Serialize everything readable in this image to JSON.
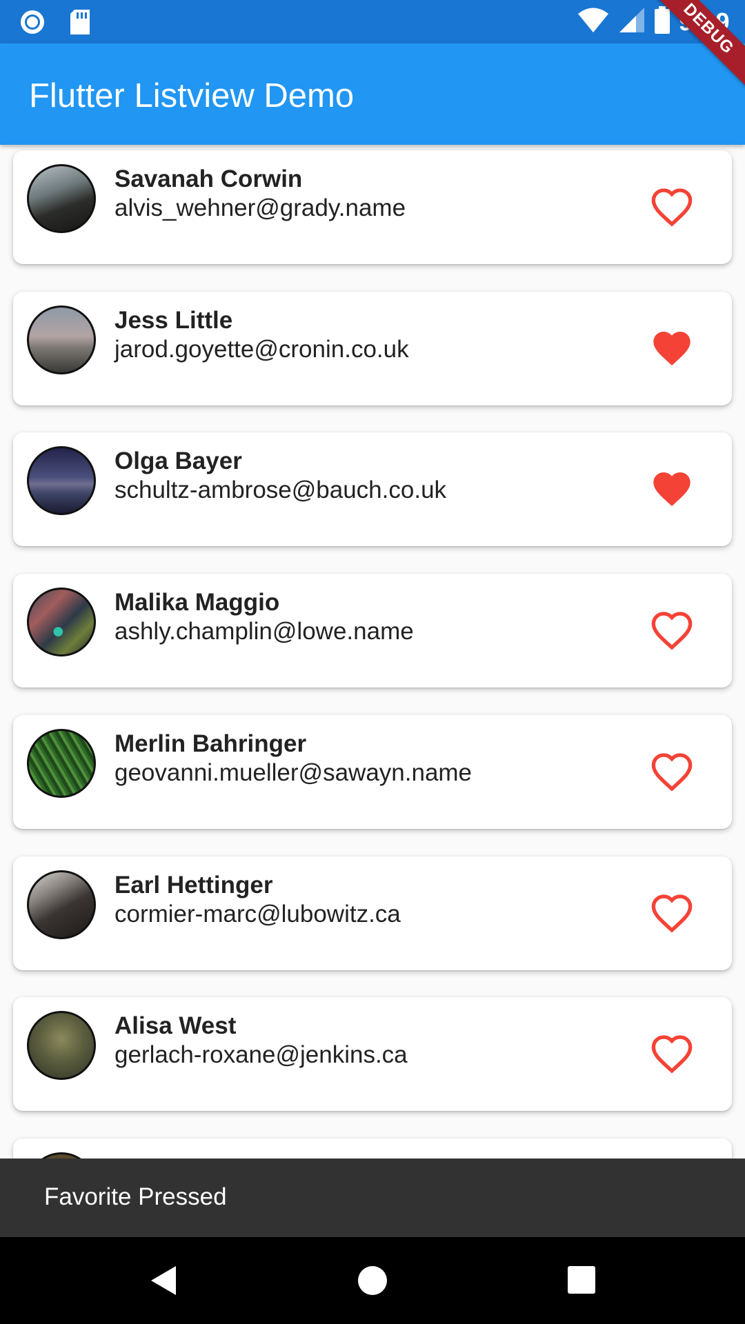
{
  "status_bar": {
    "time": "9:29",
    "left_icons": [
      "sync-icon",
      "sd-card-icon"
    ],
    "right_icons": [
      "wifi-icon",
      "signal-icon",
      "battery-icon"
    ]
  },
  "app_bar": {
    "title": "Flutter Listview Demo"
  },
  "debug_banner": "DEBUG",
  "colors": {
    "status_bar": "#1976D2",
    "app_bar": "#2196F3",
    "favorite": "#F44336",
    "snackbar": "#323232",
    "debug_banner": "#A71F2A"
  },
  "contacts": [
    {
      "name": "Savanah Corwin",
      "email": "alvis_wehner@grady.name",
      "favorite": false
    },
    {
      "name": "Jess Little",
      "email": "jarod.goyette@cronin.co.uk",
      "favorite": true
    },
    {
      "name": "Olga Bayer",
      "email": "schultz-ambrose@bauch.co.uk",
      "favorite": true
    },
    {
      "name": "Malika Maggio",
      "email": "ashly.champlin@lowe.name",
      "favorite": false
    },
    {
      "name": "Merlin Bahringer",
      "email": "geovanni.mueller@sawayn.name",
      "favorite": false
    },
    {
      "name": "Earl Hettinger",
      "email": "cormier-marc@lubowitz.ca",
      "favorite": false
    },
    {
      "name": "Alisa West",
      "email": "gerlach-roxane@jenkins.ca",
      "favorite": false
    }
  ],
  "snackbar": {
    "message": "Favorite Pressed"
  },
  "nav_bar": {
    "buttons": [
      "back-icon",
      "home-icon",
      "recents-icon"
    ]
  }
}
